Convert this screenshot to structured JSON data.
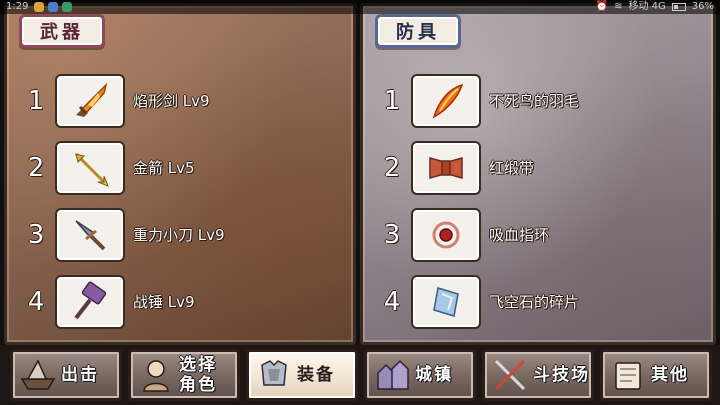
{
  "status_bar": {
    "time": "1:29",
    "carrier": "移动 4G",
    "battery": "36%"
  },
  "weapons_panel": {
    "title": "武器",
    "items": [
      {
        "index": "1",
        "name": "焰形剑 Lv9",
        "icon": "flame-sword-icon"
      },
      {
        "index": "2",
        "name": "金箭 Lv5",
        "icon": "golden-arrow-icon"
      },
      {
        "index": "3",
        "name": "重力小刀 Lv9",
        "icon": "gravity-knife-icon"
      },
      {
        "index": "4",
        "name": "战锤 Lv9",
        "icon": "war-hammer-icon"
      }
    ]
  },
  "armor_panel": {
    "title": "防具",
    "items": [
      {
        "index": "1",
        "name": "不死鸟的羽毛",
        "icon": "phoenix-feather-icon"
      },
      {
        "index": "2",
        "name": "红缎带",
        "icon": "red-ribbon-icon"
      },
      {
        "index": "3",
        "name": "吸血指环",
        "icon": "vampire-ring-icon"
      },
      {
        "index": "4",
        "name": "飞空石的碎片",
        "icon": "sky-stone-shard-icon"
      }
    ]
  },
  "nav": {
    "sortie": "出击",
    "select_character_line1": "选择",
    "select_character_line2": "角色",
    "equipment": "装备",
    "town": "城镇",
    "arena": "斗技场",
    "other": "其他",
    "active": "装备"
  }
}
